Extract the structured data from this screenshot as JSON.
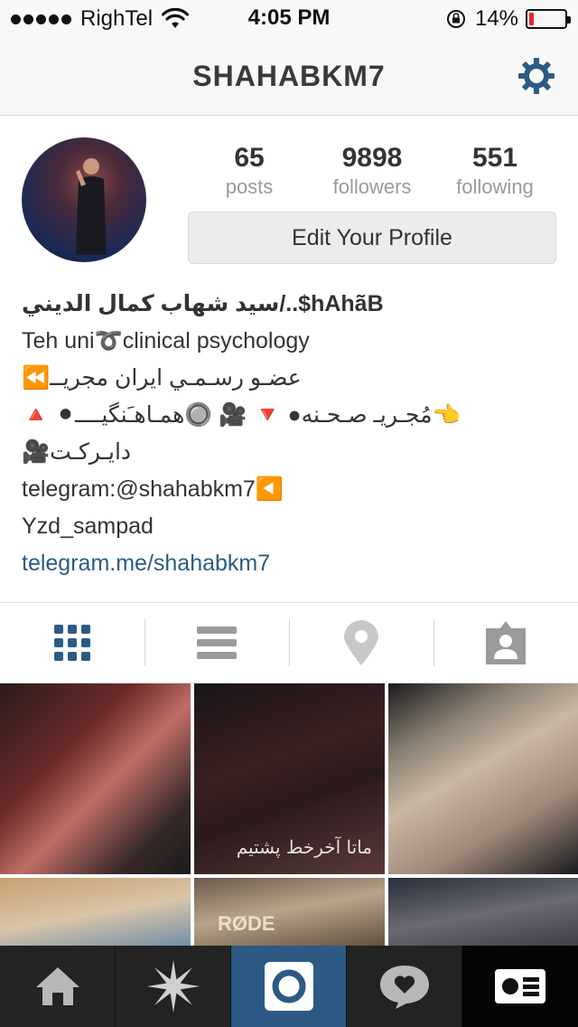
{
  "status_bar": {
    "carrier": "RighTel",
    "time": "4:05 PM",
    "battery_percent": "14%",
    "battery_level": 0.14,
    "battery_color": "#e0262b"
  },
  "header": {
    "title": "SHAHABKM7",
    "settings_icon": "gear-icon",
    "accent": "#2c5b85"
  },
  "profile": {
    "stats": [
      {
        "number": "65",
        "label": "posts"
      },
      {
        "number": "9898",
        "label": "followers"
      },
      {
        "number": "551",
        "label": "following"
      }
    ],
    "edit_button": "Edit Your Profile",
    "bio": {
      "name": "سید شهاب کمال الديني/..$hAhãB",
      "line1": "Teh uni➰clinical psychology",
      "line2": "⏪عضـو رسـمـي ایران مجریــ",
      "line3": "🔺 ⚫مُجـریـ صـحـنه● 🔻 🎥 🔘همـاهـَنگیــــ👈",
      "line4": "🎥دایـرکـت",
      "line5": "telegram:@shahabkm7◀️",
      "line6": "Yzd_sampad",
      "link": "telegram.me/shahabkm7"
    }
  },
  "view_tabs": [
    {
      "icon": "grid-icon",
      "active": true
    },
    {
      "icon": "list-icon",
      "active": false
    },
    {
      "icon": "location-pin-icon",
      "active": false
    },
    {
      "icon": "tagged-person-icon",
      "active": false
    }
  ],
  "photos": {
    "p2_caption": "ماتا آخرخط پشتیم",
    "p5_label": "RØDE"
  },
  "bottom_nav": [
    {
      "icon": "home-icon"
    },
    {
      "icon": "explore-star-icon"
    },
    {
      "icon": "camera-icon"
    },
    {
      "icon": "activity-heart-icon"
    },
    {
      "icon": "profile-card-icon"
    }
  ]
}
